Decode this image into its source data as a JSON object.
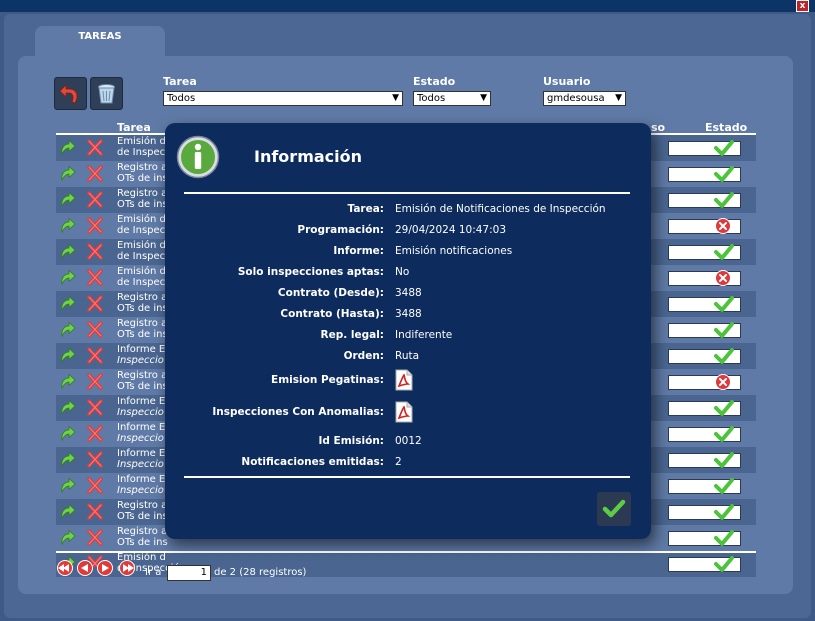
{
  "window": {
    "close_glyph": "x"
  },
  "tab": {
    "label": "TAREAS"
  },
  "filters": {
    "tarea": {
      "label": "Tarea",
      "value": "Todos"
    },
    "estado": {
      "label": "Estado",
      "value": "Todos"
    },
    "usuario": {
      "label": "Usuario",
      "value": "gmdesousa"
    }
  },
  "table": {
    "headers": {
      "tarea": "Tarea",
      "progreso": "so",
      "estado": "Estado"
    },
    "rows": [
      {
        "l1": "Emisión d",
        "l2": "de Inspecc",
        "italic": false,
        "status": "ok"
      },
      {
        "l1": "Registro a",
        "l2": "OTs de ins",
        "italic": false,
        "status": "ok"
      },
      {
        "l1": "Registro a",
        "l2": "OTs de ins",
        "italic": false,
        "status": "ok"
      },
      {
        "l1": "Emisión d",
        "l2": "de Inspecc",
        "italic": false,
        "status": "error"
      },
      {
        "l1": "Emisión d",
        "l2": "de Inspecc",
        "italic": false,
        "status": "ok"
      },
      {
        "l1": "Emisión d",
        "l2": "de Inspecc",
        "italic": false,
        "status": "error"
      },
      {
        "l1": "Registro a",
        "l2": "OTs de ins",
        "italic": false,
        "status": "ok"
      },
      {
        "l1": "Registro a",
        "l2": "OTs de ins",
        "italic": false,
        "status": "ok"
      },
      {
        "l1": "Informe E",
        "l2": "Inspeccio",
        "italic": true,
        "status": "ok"
      },
      {
        "l1": "Registro a",
        "l2": "OTs de ins",
        "italic": false,
        "status": "error"
      },
      {
        "l1": "Informe E",
        "l2": "Inspeccio",
        "italic": true,
        "status": "ok"
      },
      {
        "l1": "Informe E",
        "l2": "Inspeccio",
        "italic": true,
        "status": "ok"
      },
      {
        "l1": "Informe E",
        "l2": "Inspeccio",
        "italic": true,
        "status": "ok"
      },
      {
        "l1": "Informe E",
        "l2": "Inspeccio",
        "italic": true,
        "status": "ok"
      },
      {
        "l1": "Registro a",
        "l2": "OTs de ins",
        "italic": false,
        "status": "ok"
      },
      {
        "l1": "Registro a",
        "l2": "OTs de ins",
        "italic": false,
        "status": "ok"
      },
      {
        "l1": "Emisión d",
        "l2": "de Inspección",
        "italic": false,
        "status": "ok"
      }
    ]
  },
  "pagination": {
    "goto_label": "Ir a",
    "page": "1",
    "summary": "de 2 (28 registros)"
  },
  "modal": {
    "title": "Información",
    "fields": [
      {
        "label": "Tarea:",
        "value": "Emisión de Notificaciones de Inspección"
      },
      {
        "label": "Programación:",
        "value": "29/04/2024 10:47:03"
      },
      {
        "label": "Informe:",
        "value": "Emisión notificaciones"
      },
      {
        "label": "Solo inspecciones aptas:",
        "value": "No"
      },
      {
        "label": "Contrato (Desde):",
        "value": "3488"
      },
      {
        "label": "Contrato (Hasta):",
        "value": "3488"
      },
      {
        "label": "Rep. legal:",
        "value": "Indiferente"
      },
      {
        "label": "Orden:",
        "value": "Ruta"
      },
      {
        "label": "Emision Pegatinas:",
        "value": ""
      },
      {
        "label": "Inspecciones Con Anomalias:",
        "value": ""
      },
      {
        "label": "Id Emisión:",
        "value": "0012"
      },
      {
        "label": "Notificaciones emitidas:",
        "value": "2"
      }
    ]
  },
  "icons": {
    "undo": "undo-icon",
    "trash": "trash-icon",
    "info": "info-icon",
    "pdf": "pdf-icon",
    "ok": "check-icon",
    "error": "error-icon",
    "rerun": "rerun-arrow-icon",
    "delete": "delete-x-icon"
  },
  "colors": {
    "header": "#0c3466",
    "modal_bg": "#0d2c5d",
    "ok_green": "#4cc43a",
    "error_red": "#e0393c"
  }
}
